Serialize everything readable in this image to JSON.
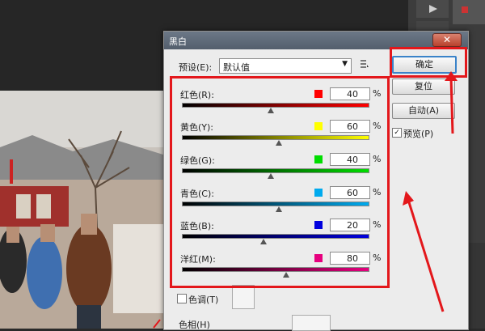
{
  "dialog": {
    "title": "黑白",
    "close_glyph": "✕",
    "preset_label": "预设(E):",
    "preset_value": "默认值",
    "buttons": {
      "ok": "确定",
      "reset": "复位",
      "auto": "自动(A)"
    },
    "preview_label": "预览(P)",
    "preview_checked": "✓",
    "sliders": [
      {
        "label": "红色(R):",
        "value": "40",
        "color": "#ff0000",
        "fraction": 0.48
      },
      {
        "label": "黄色(Y):",
        "value": "60",
        "color": "#ffff00",
        "fraction": 0.52
      },
      {
        "label": "绿色(G):",
        "value": "40",
        "color": "#00dd00",
        "fraction": 0.48
      },
      {
        "label": "青色(C):",
        "value": "60",
        "color": "#00aaee",
        "fraction": 0.52
      },
      {
        "label": "蓝色(B):",
        "value": "20",
        "color": "#0000dd",
        "fraction": 0.44
      },
      {
        "label": "洋红(M):",
        "value": "80",
        "color": "#e6007e",
        "fraction": 0.56
      }
    ],
    "percent": "%",
    "tint_label": "色调(T)",
    "hue_label": "色相(H)"
  },
  "colors": {
    "highlight": "#e3171b"
  }
}
